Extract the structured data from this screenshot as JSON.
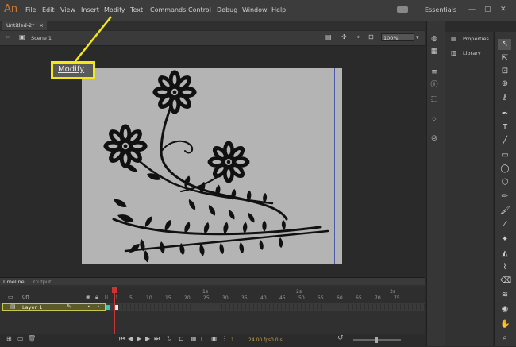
{
  "app": {
    "logo": "An",
    "workspace": "Essentials"
  },
  "menu": [
    "File",
    "Edit",
    "View",
    "Insert",
    "Modify",
    "Text",
    "Commands",
    "Control",
    "Debug",
    "Window",
    "Help"
  ],
  "document": {
    "tab_label": "Untitled-2*",
    "scene_label": "Scene 1",
    "zoom": "100%"
  },
  "callout": {
    "label": "Modify"
  },
  "timeline": {
    "tabs": [
      "Timeline",
      "Output"
    ],
    "off_label": "Off",
    "layer_name": "Layer_1",
    "frame_ticks": [
      "1",
      "5",
      "10",
      "15",
      "20",
      "25",
      "30",
      "35",
      "40",
      "45",
      "50",
      "55",
      "60",
      "65",
      "70",
      "75"
    ],
    "second_marks": [
      "1s",
      "2s",
      "3s"
    ],
    "current_frame": "1",
    "fps": "24.00 fps",
    "elapsed": "0.0 s"
  },
  "panels": {
    "properties": "Properties",
    "library": "Library"
  },
  "colors": {
    "highlight": "#f3e61b",
    "playhead": "#cc3333",
    "stage": "#b4b4b4",
    "artwork": "#111111"
  },
  "icons": [
    "selection-tool-icon",
    "subselection-tool-icon",
    "free-transform-icon",
    "3d-rotation-icon",
    "lasso-icon",
    "pen-icon",
    "text-tool-icon",
    "line-tool-icon",
    "rectangle-tool-icon",
    "oval-tool-icon",
    "polystar-icon",
    "pencil-icon",
    "paint-brush-icon",
    "brush-icon",
    "bone-tool-icon",
    "paint-bucket-icon",
    "eyedropper-icon",
    "eraser-icon",
    "width-tool-icon",
    "hand-tool-icon"
  ]
}
